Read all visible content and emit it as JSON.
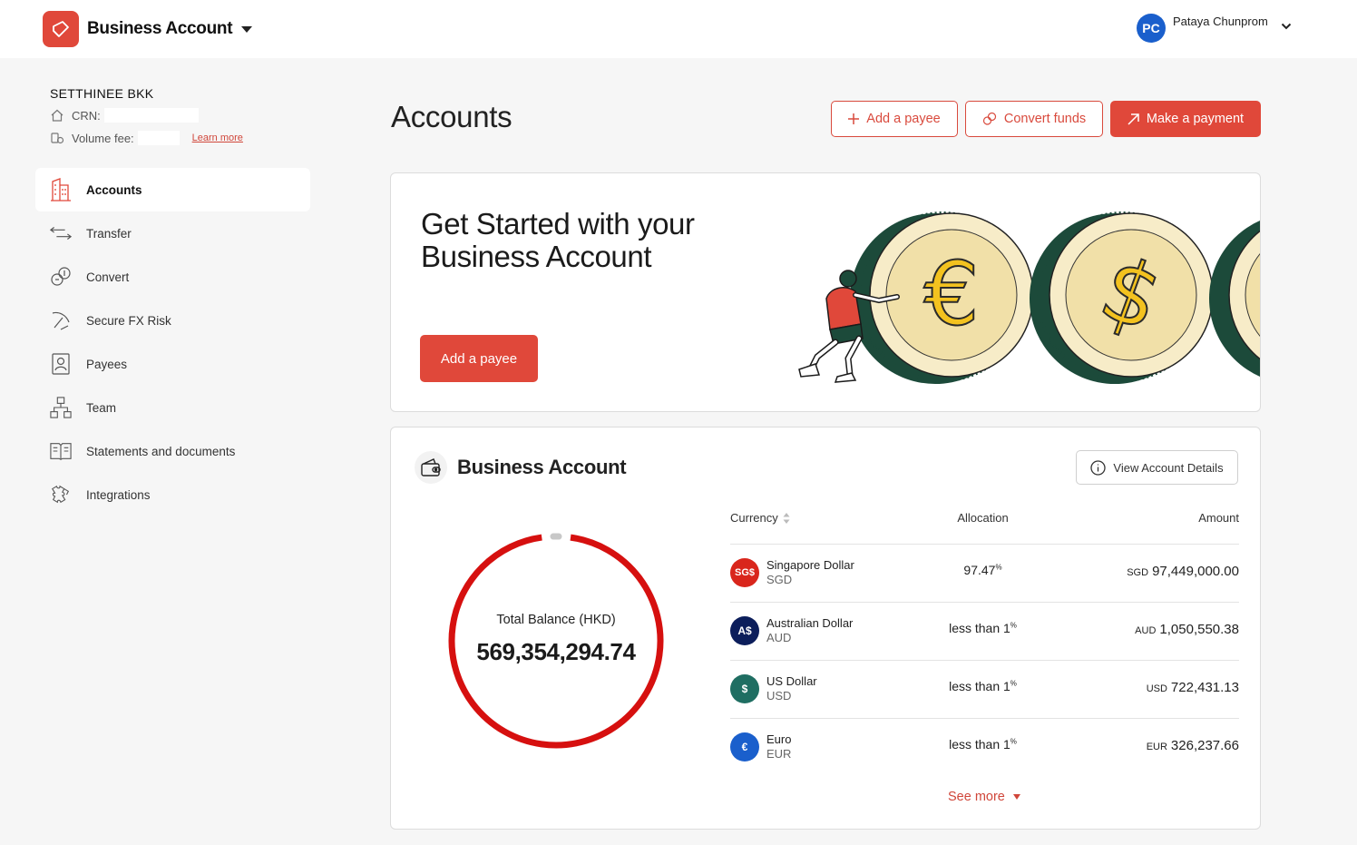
{
  "header": {
    "brand_title": "Business Account",
    "user_initials": "PC",
    "user_name": "Pataya Chunprom",
    "accent": "#e0483a"
  },
  "org": {
    "name": "SETTHINEE BKK",
    "crn_label": "CRN:",
    "volume_fee_label": "Volume fee:",
    "learn_more": "Learn more"
  },
  "sidebar": {
    "items": [
      {
        "label": "Accounts",
        "icon": "building-icon",
        "active": true
      },
      {
        "label": "Transfer",
        "icon": "transfer-arrows-icon"
      },
      {
        "label": "Convert",
        "icon": "currency-convert-icon"
      },
      {
        "label": "Secure FX Risk",
        "icon": "shield-pick-icon"
      },
      {
        "label": "Payees",
        "icon": "contact-card-icon"
      },
      {
        "label": "Team",
        "icon": "team-tree-icon"
      },
      {
        "label": "Statements and documents",
        "icon": "book-icon"
      },
      {
        "label": "Integrations",
        "icon": "puzzle-icon"
      }
    ]
  },
  "main": {
    "title": "Accounts",
    "actions": {
      "add_payee": "Add a payee",
      "convert_funds": "Convert funds",
      "make_payment": "Make a payment"
    },
    "hero": {
      "title_line1": "Get Started with your",
      "title_line2": "Business Account",
      "cta": "Add a payee"
    },
    "account": {
      "title": "Business Account",
      "view_details": "View Account Details",
      "total_label": "Total Balance (HKD)",
      "total_value": "569,354,294.74",
      "columns": {
        "currency": "Currency",
        "allocation": "Allocation",
        "amount": "Amount"
      },
      "rows": [
        {
          "symbol": "SG$",
          "name": "Singapore Dollar",
          "code": "SGD",
          "allocation": "97.47",
          "amount_code": "SGD",
          "amount": "97,449,000.00",
          "color": "#d9261c"
        },
        {
          "symbol": "A$",
          "name": "Australian Dollar",
          "code": "AUD",
          "allocation": "less than 1",
          "amount_code": "AUD",
          "amount": "1,050,550.38",
          "color": "#0c1e5b"
        },
        {
          "symbol": "$",
          "name": "US Dollar",
          "code": "USD",
          "allocation": "less than 1",
          "amount_code": "USD",
          "amount": "722,431.13",
          "color": "#1f6e62"
        },
        {
          "symbol": "€",
          "name": "Euro",
          "code": "EUR",
          "allocation": "less than 1",
          "amount_code": "EUR",
          "amount": "326,237.66",
          "color": "#1a5fcc"
        }
      ],
      "percent_sign": "%",
      "see_more": "See more"
    }
  }
}
